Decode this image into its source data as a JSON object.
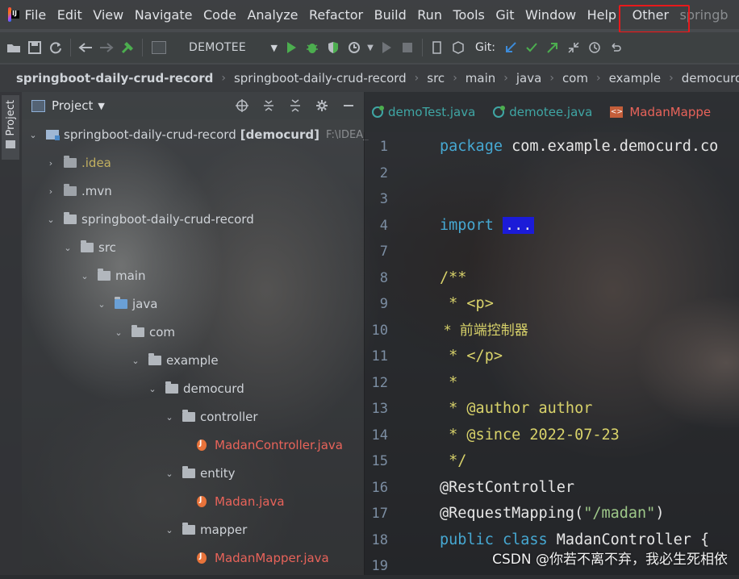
{
  "menubar": {
    "logo_text": "IJ",
    "items": [
      "File",
      "Edit",
      "View",
      "Navigate",
      "Code",
      "Analyze",
      "Refactor",
      "Build",
      "Run",
      "Tools",
      "Git",
      "Window",
      "Help"
    ],
    "other": "Other",
    "title_fragment": "springb"
  },
  "toolbar": {
    "run_config": "DEMOTEE",
    "git_label": "Git:"
  },
  "breadcrumb": [
    "springboot-daily-crud-record",
    "springboot-daily-crud-record",
    "src",
    "main",
    "java",
    "com",
    "example",
    "democurd"
  ],
  "left_stripe": {
    "tab": "Project"
  },
  "project_panel": {
    "title": "Project",
    "tree": [
      {
        "label": "springboot-daily-crud-record",
        "suffix": "[democurd]",
        "path": "F:\\IDEA_"
      },
      {
        "label": ".idea"
      },
      {
        "label": ".mvn"
      },
      {
        "label": "springboot-daily-crud-record"
      },
      {
        "label": "src"
      },
      {
        "label": "main"
      },
      {
        "label": "java"
      },
      {
        "label": "com"
      },
      {
        "label": "example"
      },
      {
        "label": "democurd"
      },
      {
        "label": "controller"
      },
      {
        "label": "MadanController.java"
      },
      {
        "label": "entity"
      },
      {
        "label": "Madan.java"
      },
      {
        "label": "mapper"
      },
      {
        "label": "MadanMapper.java"
      }
    ]
  },
  "editor": {
    "tabs": [
      "demoTest.java",
      "demotee.java",
      "MadanMappe"
    ],
    "line_numbers": [
      "1",
      "2",
      "3",
      "4",
      "7",
      "8",
      "9",
      "10",
      "11",
      "12",
      "13",
      "14",
      "15",
      "16",
      "17",
      "18",
      "19"
    ],
    "code": {
      "l1_kw": "package",
      "l1_rest": " com.example.democurd.co",
      "l4_kw": "import",
      "l4_fold": "...",
      "l8": "/**",
      "l9": " * <p>",
      "l10": " *  前端控制器",
      "l11": " * </p>",
      "l12": " *",
      "l13": " * @author author",
      "l14": " * @since 2022-07-23",
      "l15": " */",
      "l16": "@RestController",
      "l17_a": "@RequestMapping(",
      "l17_s": "\"/madan\"",
      "l17_b": ")",
      "l18_kw": "public class",
      "l18_rest": " MadanController {"
    }
  },
  "watermark": "CSDN @你若不离不弃，我必生死相依",
  "colors": {
    "highlight_box": "#e8191b",
    "keyword": "#46a8d2",
    "comment": "#d8d26a",
    "string": "#9ec889",
    "error_file": "#e8635a"
  }
}
